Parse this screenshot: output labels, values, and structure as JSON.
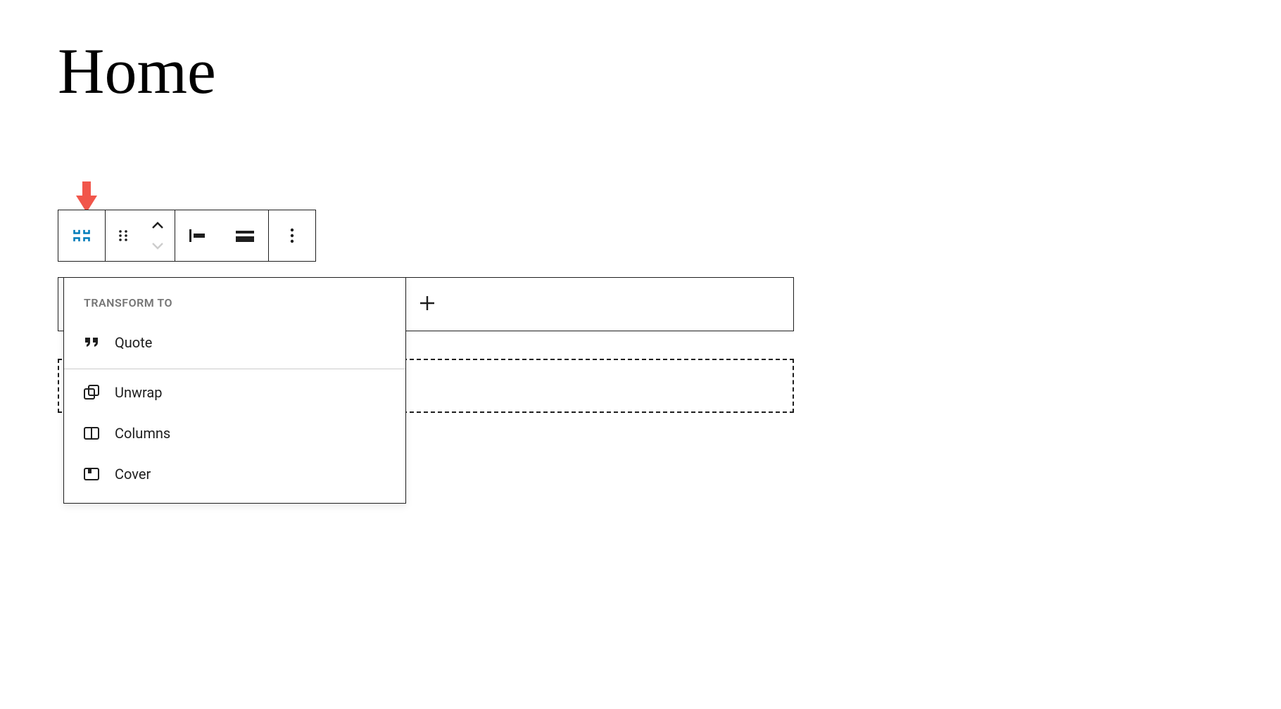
{
  "title": "Home",
  "toolbar": {
    "block_type": "group",
    "align_left": "align-left",
    "align_wide": "align-wide",
    "more": "more-options"
  },
  "dropdown": {
    "header": "Transform to",
    "items": [
      {
        "icon": "quote-icon",
        "label": "Quote"
      }
    ],
    "items2": [
      {
        "icon": "unwrap-icon",
        "label": "Unwrap"
      },
      {
        "icon": "columns-icon",
        "label": "Columns"
      },
      {
        "icon": "cover-icon",
        "label": "Cover"
      }
    ]
  }
}
